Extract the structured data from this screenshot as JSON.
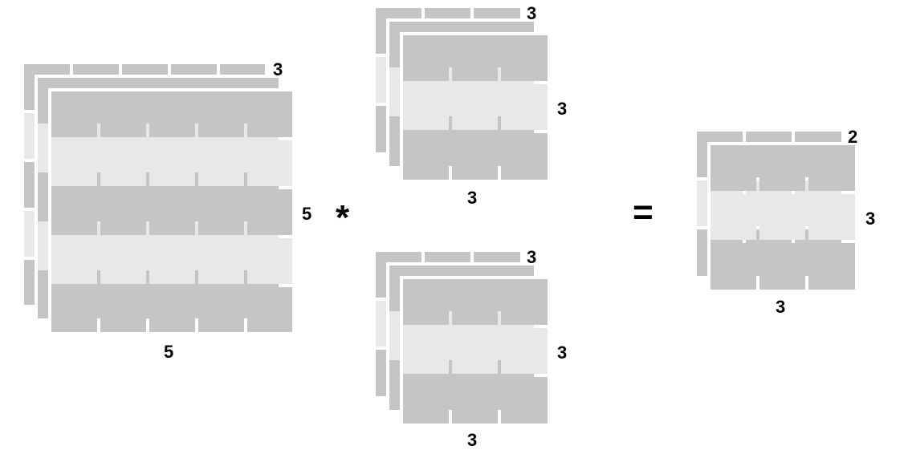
{
  "diagram": {
    "description": "Convolution: a 5x5x3 input convolved with two 3x3x3 filters yields a 3x3x2 output.",
    "input": {
      "height": 5,
      "width": 5,
      "depth": 3,
      "label_height": "5",
      "label_width": "5",
      "label_depth": "3"
    },
    "filters": [
      {
        "height": 3,
        "width": 3,
        "depth": 3,
        "label_height": "3",
        "label_width": "3",
        "label_depth": "3"
      },
      {
        "height": 3,
        "width": 3,
        "depth": 3,
        "label_height": "3",
        "label_width": "3",
        "label_depth": "3"
      }
    ],
    "output": {
      "height": 3,
      "width": 3,
      "depth": 2,
      "label_height": "3",
      "label_width": "3",
      "label_depth": "2"
    },
    "operators": {
      "convolve": "*",
      "equals": "="
    },
    "colors": {
      "dark_cell": "#c5c5c5",
      "light_cell": "#e8e8e8",
      "gap": "#ffffff",
      "text": "#000000"
    }
  }
}
